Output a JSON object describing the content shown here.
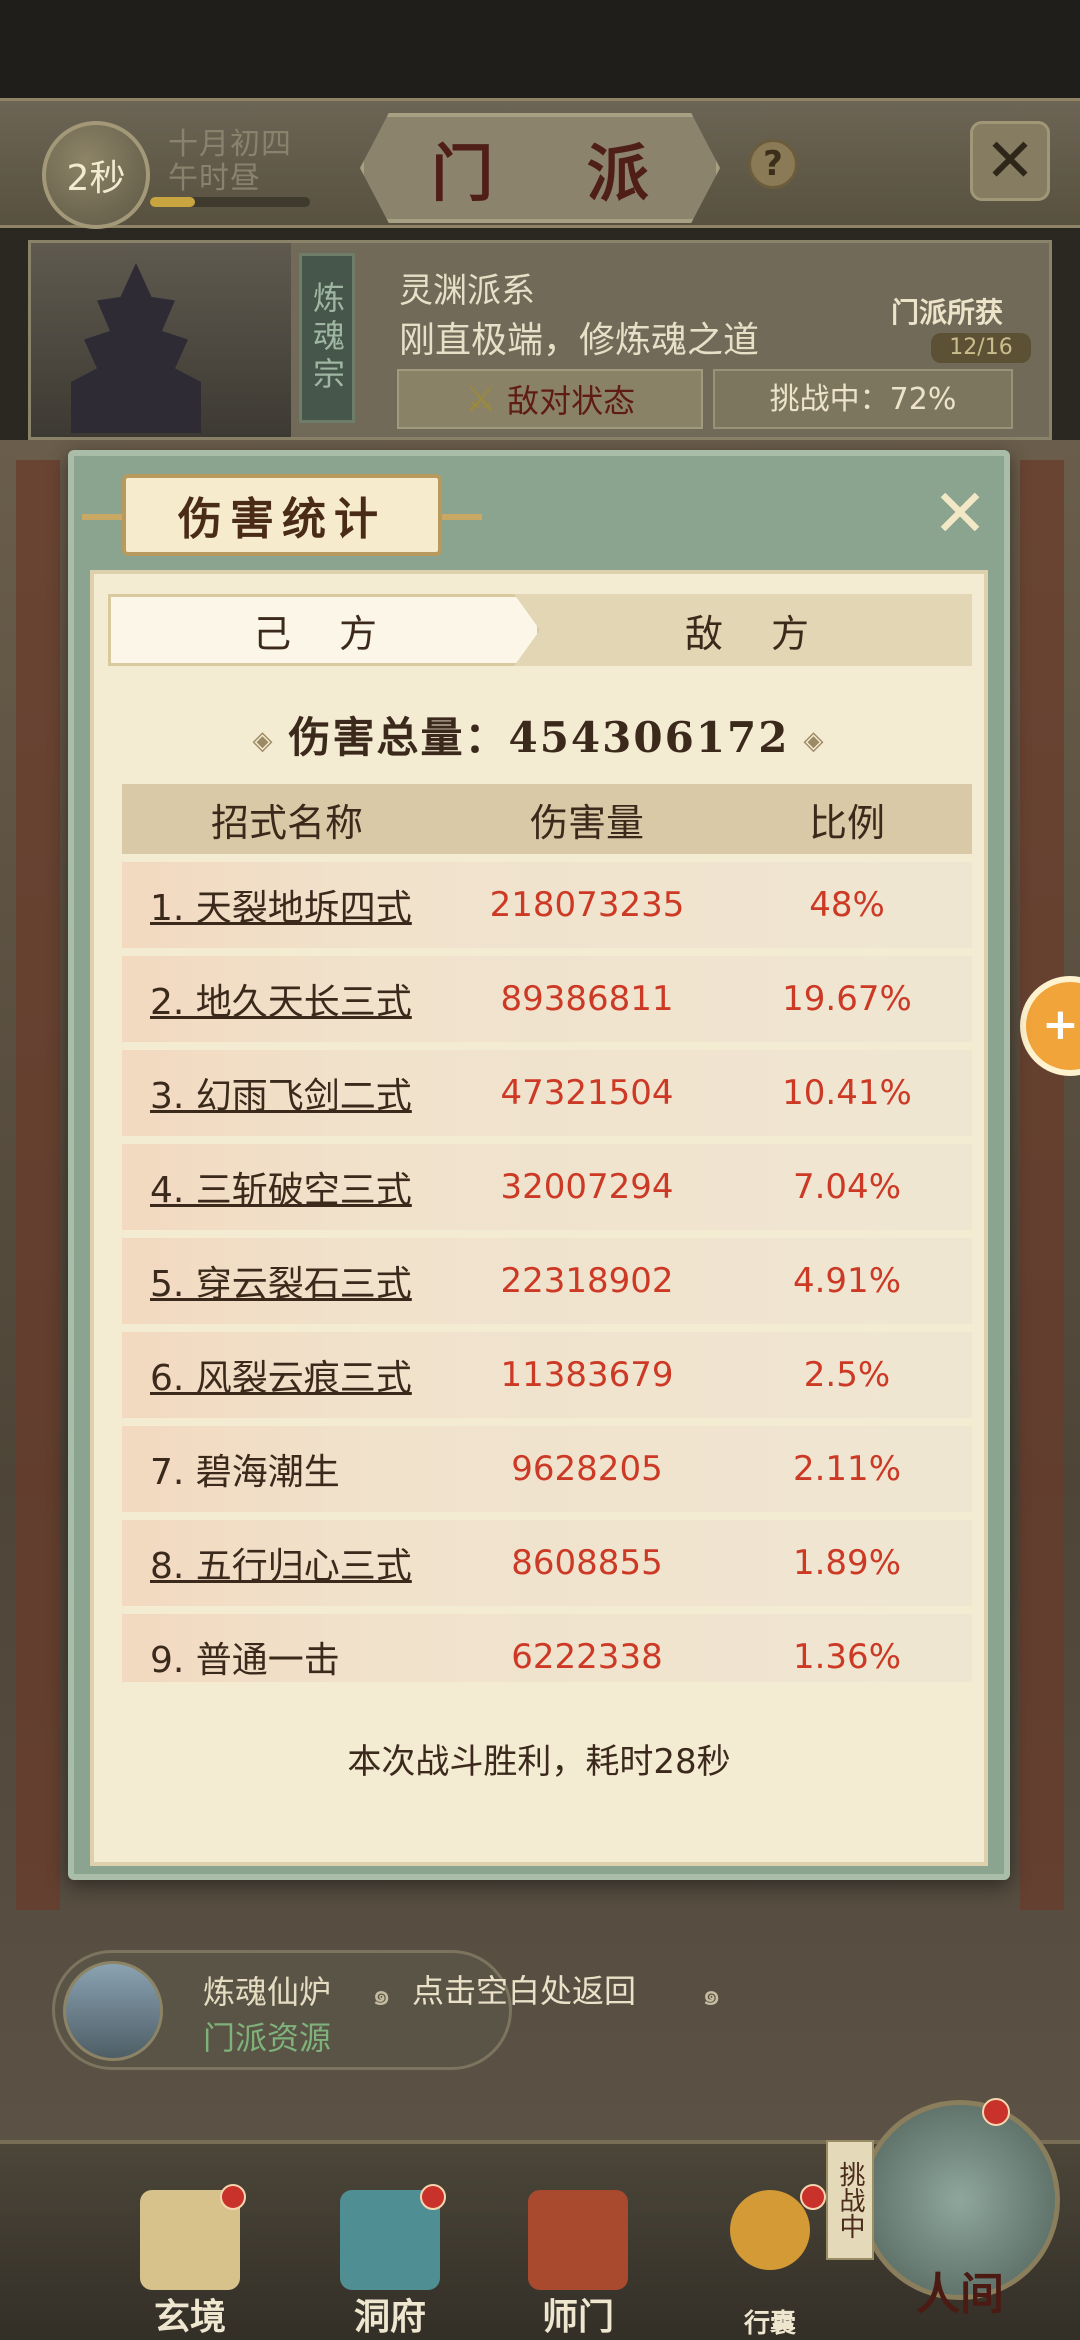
{
  "header": {
    "timer": "2秒",
    "date_line1": "十月初四",
    "date_line2": "午时昼",
    "title": "门 派",
    "help_icon": "question-icon",
    "close_icon": "close-icon"
  },
  "sect": {
    "tag": "炼魂宗",
    "name": "灵渊派系",
    "desc": "刚直极端，修炼魂之道",
    "loot_label": "门派所获",
    "loot_count": "12/16",
    "hostile_label": "敌对状态",
    "challenge_status": "挑战中：72%"
  },
  "dialog": {
    "title": "伤害统计",
    "tabs": [
      "己 方",
      "敌 方"
    ],
    "active_tab": 0,
    "total_label": "伤害总量：454306172",
    "columns": [
      "招式名称",
      "伤害量",
      "比例"
    ],
    "rows": [
      {
        "name": "1. 天裂地坼四式",
        "damage": "218073235",
        "pct": "48%",
        "link": true
      },
      {
        "name": "2. 地久天长三式",
        "damage": "89386811",
        "pct": "19.67%",
        "link": true
      },
      {
        "name": "3. 幻雨飞剑二式",
        "damage": "47321504",
        "pct": "10.41%",
        "link": true
      },
      {
        "name": "4. 三斩破空三式",
        "damage": "32007294",
        "pct": "7.04%",
        "link": true
      },
      {
        "name": "5. 穿云裂石三式",
        "damage": "22318902",
        "pct": "4.91%",
        "link": true
      },
      {
        "name": "6. 风裂云痕三式",
        "damage": "11383679",
        "pct": "2.5%",
        "link": true
      },
      {
        "name": "7. 碧海潮生",
        "damage": "9628205",
        "pct": "2.11%",
        "link": false
      },
      {
        "name": "8. 五行归心三式",
        "damage": "8608855",
        "pct": "1.89%",
        "link": true
      },
      {
        "name": "9. 普通一击",
        "damage": "6222338",
        "pct": "1.36%",
        "link": false
      }
    ],
    "victory_text": "本次战斗胜利，耗时28秒"
  },
  "resource": {
    "title": "炼魂仙炉",
    "subtitle": "门派资源"
  },
  "back_hint": "点击空白处返回",
  "nav": {
    "items": [
      "玄境",
      "洞府",
      "师门",
      "行囊"
    ],
    "challenge_tag": "挑战中",
    "human_label": "人间"
  },
  "colors": {
    "damage_red": "#cc3a26",
    "dialog_green": "#8aa48f",
    "parchment": "#f4ebd3"
  }
}
